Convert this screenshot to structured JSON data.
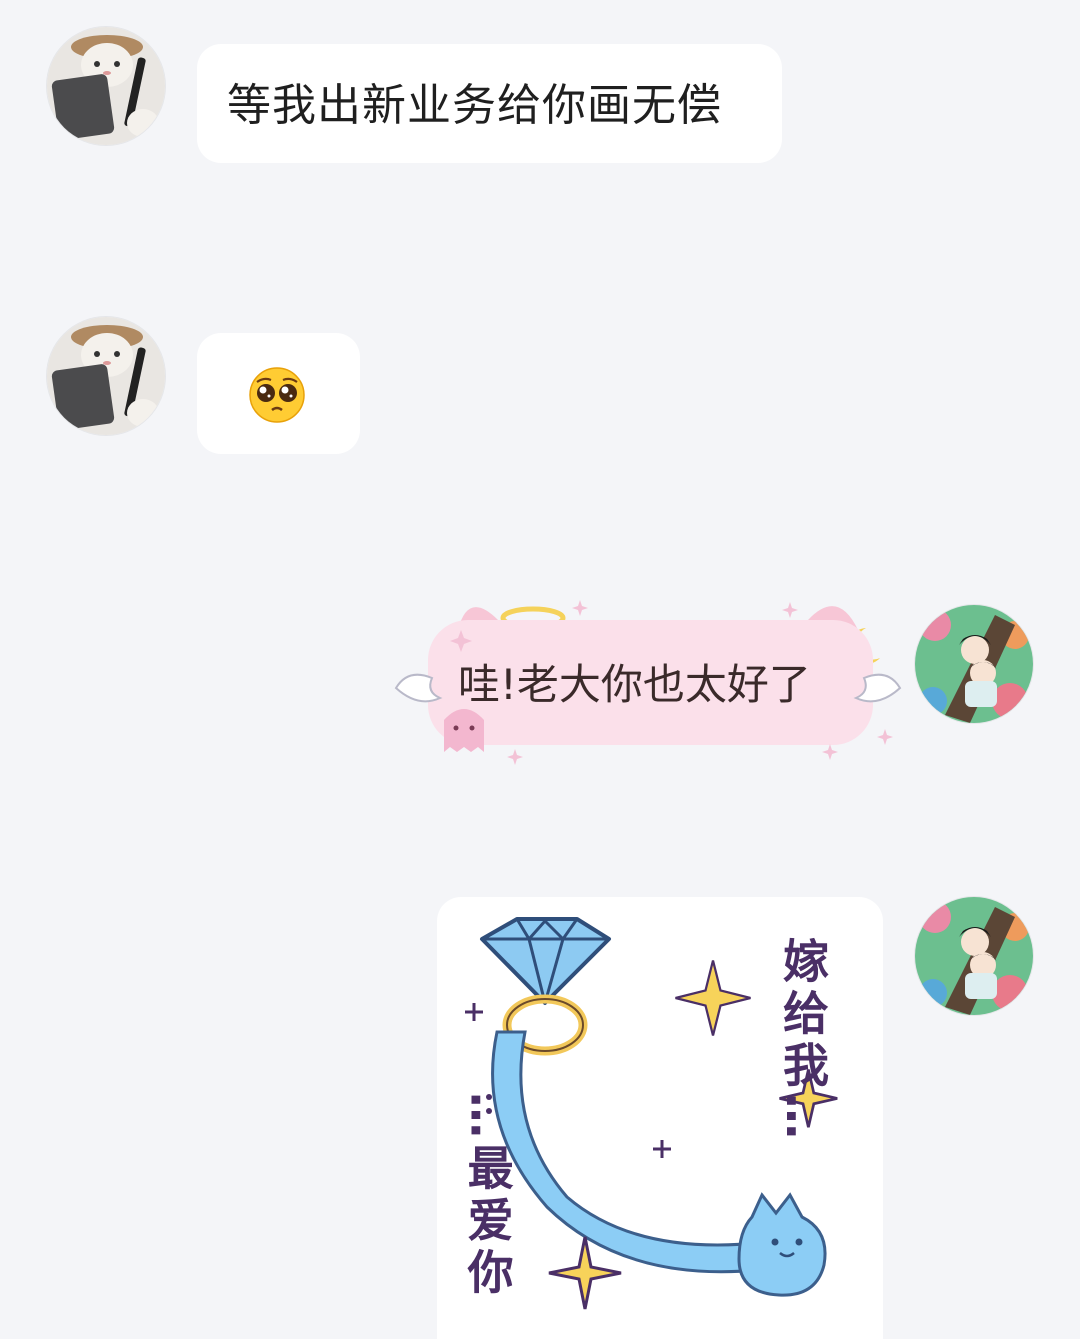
{
  "messages": [
    {
      "sender": "other",
      "type": "text",
      "text": "等我出新业务给你画无偿"
    },
    {
      "sender": "other",
      "type": "emoji",
      "emoji": "pleading-face"
    },
    {
      "sender": "me",
      "type": "text",
      "text": "哇!老大你也太好了"
    },
    {
      "sender": "me",
      "type": "sticker",
      "sticker": {
        "line1": "嫁给我…",
        "line2": "…最爱你"
      }
    }
  ],
  "avatars": {
    "other": "cat-with-tablet-avatar",
    "me": "anime-couple-avatar"
  },
  "colors": {
    "background": "#f4f5f8",
    "bubble": "#ffffff",
    "pink_bubble": "#fbe0ea",
    "diamond": "#7ec3f0",
    "sticker_text": "#4a2f66",
    "sparkle": "#f7d35a"
  }
}
